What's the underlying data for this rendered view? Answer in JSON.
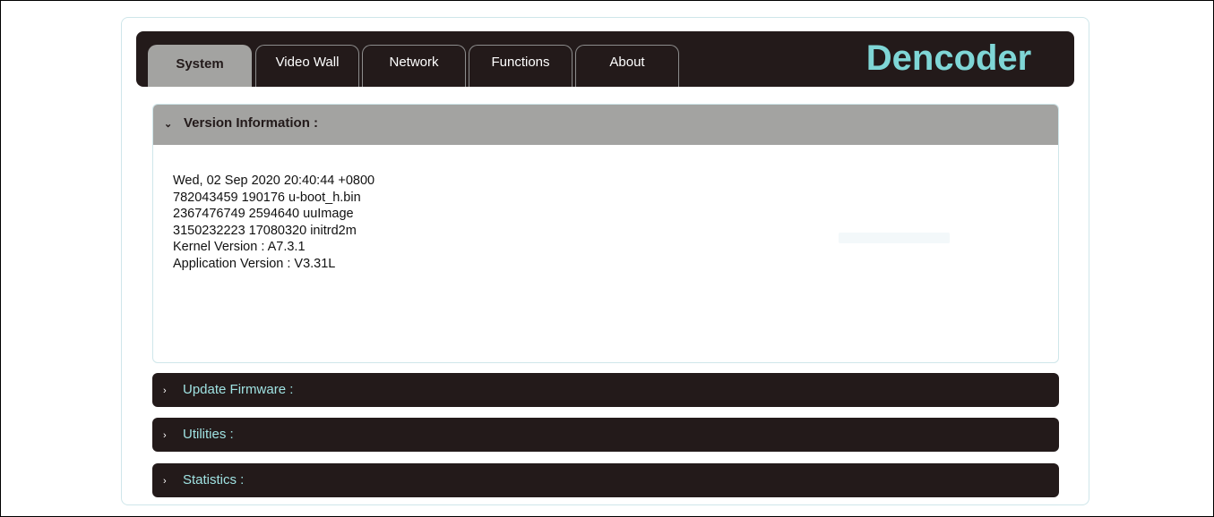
{
  "tabs": [
    {
      "label": "System",
      "active": true
    },
    {
      "label": "Video Wall",
      "active": false
    },
    {
      "label": "Network",
      "active": false
    },
    {
      "label": "Functions",
      "active": false
    },
    {
      "label": "About",
      "active": false
    }
  ],
  "brand": "Dencoder",
  "sections": {
    "version": {
      "title": "Version Information :",
      "lines": [
        "Wed, 02 Sep 2020 20:40:44 +0800",
        "782043459 190176 u-boot_h.bin",
        "2367476749 2594640 uuImage",
        "3150232223 17080320 initrd2m",
        "Kernel Version : A7.3.1",
        "Application Version : V3.31L"
      ]
    },
    "update_firmware": {
      "title": "Update Firmware :"
    },
    "utilities": {
      "title": "Utilities :"
    },
    "statistics": {
      "title": "Statistics :"
    }
  },
  "icons": {
    "expanded": "chevron-down-icon",
    "collapsed": "chevron-right-icon"
  },
  "colors": {
    "header_bg": "#231a1a",
    "active_tab_bg": "#a3a3a1",
    "brand_text": "#7fd6d6",
    "section_title": "#9fe2e2"
  }
}
